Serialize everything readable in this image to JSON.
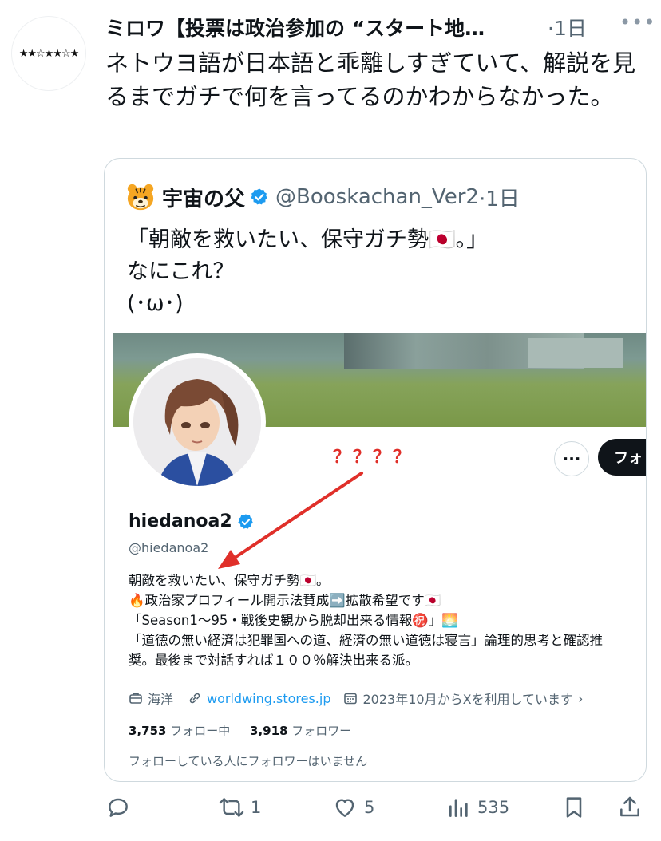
{
  "post": {
    "author_name": "ミロワ【投票は政治参加の “スタート地…",
    "time": "·1日",
    "more_icon": "more-horizontal-icon",
    "text": "ネトウヨ語が日本語と乖離しすぎていて、解説を見るまでガチで何を言ってるのかわからなかった。"
  },
  "quote": {
    "emoji": "tiger-face-emoji",
    "name": "宇宙の父",
    "handle": "@Booskachan_Ver2",
    "time": "·1日",
    "lines": [
      "「朝敵を救いたい、保守ガチ勢🇯🇵。」",
      "なにこれ？",
      "(･ω･)"
    ]
  },
  "profile": {
    "follow_label": "フォ",
    "annotation": "？？？？",
    "name": "hiedanoa2",
    "handle": "@hiedanoa2",
    "bio": [
      "朝敵を救いたい、保守ガチ勢🇯🇵。",
      "🔥政治家プロフィール開示法賛成➡️拡散希望です🇯🇵",
      "「Season1〜95・戦後史観から脱却出来る情報㊗️」🌅",
      "「道徳の無い経済は犯罪国への道、経済の無い道徳は寝言」論理的思考と確認推",
      "奨。最後まで対話すれば１００％解決出来る派。"
    ],
    "location": "海洋",
    "link": "worldwing.stores.jp",
    "joined": "2023年10月からXを利用しています",
    "following_count": "3,753",
    "following_label": " フォロー中",
    "followers_count": "3,918",
    "followers_label": " フォロワー",
    "note": "フォローしている人にフォロワーはいません"
  },
  "actions": {
    "retweets": "1",
    "likes": "5",
    "views": "535"
  },
  "colors": {
    "text": "#0f1419",
    "secondary": "#536471",
    "link": "#1d9bf0",
    "annotation": "#e0302a",
    "verified": "#1d9bf0"
  }
}
